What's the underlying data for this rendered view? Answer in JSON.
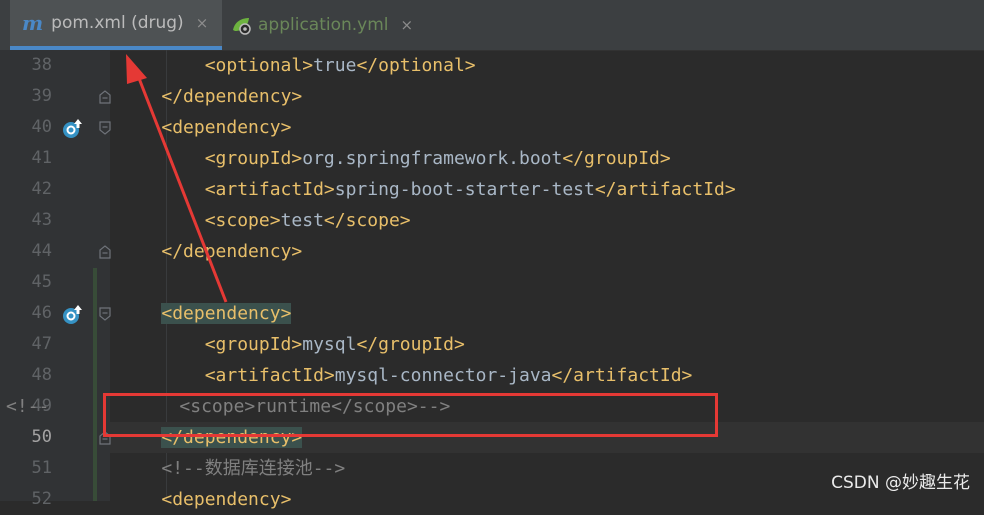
{
  "tabs": [
    {
      "label": "pom.xml (drug)",
      "active": true,
      "icon": "maven-m-icon"
    },
    {
      "label": "application.yml",
      "active": false,
      "icon": "spring-yml-icon"
    }
  ],
  "close_glyph": "×",
  "maven_glyph": "m",
  "lines": [
    {
      "num": "38",
      "parts": [
        [
          "",
          "        "
        ],
        [
          "tag",
          "<optional>"
        ],
        [
          "txt",
          "true"
        ],
        [
          "tag",
          "</optional>"
        ]
      ]
    },
    {
      "num": "39",
      "parts": [
        [
          "",
          "    "
        ],
        [
          "tag",
          "</dependency>"
        ]
      ]
    },
    {
      "num": "40",
      "parts": [
        [
          "",
          "    "
        ],
        [
          "tag",
          "<dependency>"
        ]
      ]
    },
    {
      "num": "41",
      "parts": [
        [
          "",
          "        "
        ],
        [
          "tag",
          "<groupId>"
        ],
        [
          "txt",
          "org.springframework.boot"
        ],
        [
          "tag",
          "</groupId>"
        ]
      ]
    },
    {
      "num": "42",
      "parts": [
        [
          "",
          "        "
        ],
        [
          "tag",
          "<artifactId>"
        ],
        [
          "txt",
          "spring-boot-starter-test"
        ],
        [
          "tag",
          "</artifactId>"
        ]
      ]
    },
    {
      "num": "43",
      "parts": [
        [
          "",
          "        "
        ],
        [
          "tag",
          "<scope>"
        ],
        [
          "txt",
          "test"
        ],
        [
          "tag",
          "</scope>"
        ]
      ]
    },
    {
      "num": "44",
      "parts": [
        [
          "",
          "    "
        ],
        [
          "tag",
          "</dependency>"
        ]
      ]
    },
    {
      "num": "45",
      "parts": []
    },
    {
      "num": "46",
      "parts": [
        [
          "",
          "    "
        ],
        [
          "tag match",
          "<dependency>"
        ]
      ]
    },
    {
      "num": "47",
      "parts": [
        [
          "",
          "        "
        ],
        [
          "tag",
          "<groupId>"
        ],
        [
          "txt",
          "mysql"
        ],
        [
          "tag",
          "</groupId>"
        ]
      ]
    },
    {
      "num": "48",
      "parts": [
        [
          "",
          "        "
        ],
        [
          "tag",
          "<artifactId>"
        ],
        [
          "txt",
          "mysql-connector-java"
        ],
        [
          "tag",
          "</artifactId>"
        ]
      ]
    },
    {
      "num": "49",
      "parts": [
        [
          "cmt",
          "<!--            <scope>runtime</scope>-->"
        ]
      ]
    },
    {
      "num": "50",
      "parts": [
        [
          "",
          "    "
        ],
        [
          "tag match",
          "</dependency>"
        ]
      ]
    },
    {
      "num": "51",
      "parts": [
        [
          "",
          "    "
        ],
        [
          "cmt",
          "<!--数据库连接池-->"
        ]
      ]
    },
    {
      "num": "52",
      "parts": [
        [
          "",
          "    "
        ],
        [
          "tag",
          "<dependency>"
        ]
      ]
    }
  ],
  "watermark": "CSDN @妙趣生花",
  "colors": {
    "tag": "#e8bf6a",
    "text": "#a9b7c6",
    "comment": "#808080",
    "annotation": "#e53935"
  }
}
